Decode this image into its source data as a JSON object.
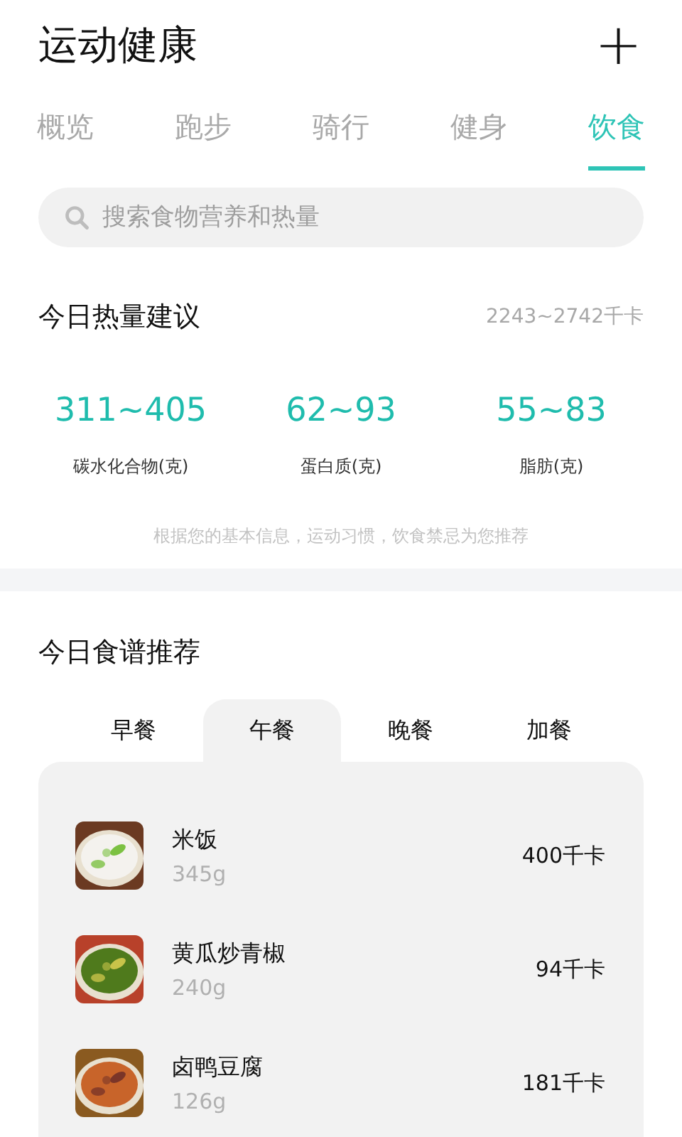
{
  "header": {
    "title": "运动健康",
    "add_icon": "+"
  },
  "tabs": [
    {
      "label": "概览",
      "selected": false
    },
    {
      "label": "跑步",
      "selected": false
    },
    {
      "label": "骑行",
      "selected": false
    },
    {
      "label": "健身",
      "selected": false
    },
    {
      "label": "饮食",
      "selected": true
    }
  ],
  "search": {
    "placeholder": "搜索食物营养和热量"
  },
  "calorie_advice": {
    "title": "今日热量建议",
    "range": "2243~2742千卡",
    "macros": [
      {
        "value": "311~405",
        "label": "碳水化合物(克)"
      },
      {
        "value": "62~93",
        "label": "蛋白质(克)"
      },
      {
        "value": "55~83",
        "label": "脂肪(克)"
      }
    ],
    "note": "根据您的基本信息，运动习惯，饮食禁忌为您推荐"
  },
  "recipes": {
    "title": "今日食谱推荐",
    "meal_tabs": [
      {
        "label": "早餐",
        "selected": false
      },
      {
        "label": "午餐",
        "selected": true
      },
      {
        "label": "晚餐",
        "selected": false
      },
      {
        "label": "加餐",
        "selected": false
      }
    ],
    "foods": [
      {
        "name": "米饭",
        "weight": "345g",
        "calories": "400千卡"
      },
      {
        "name": "黄瓜炒青椒",
        "weight": "240g",
        "calories": "94千卡"
      },
      {
        "name": "卤鸭豆腐",
        "weight": "126g",
        "calories": "181千卡"
      }
    ]
  }
}
